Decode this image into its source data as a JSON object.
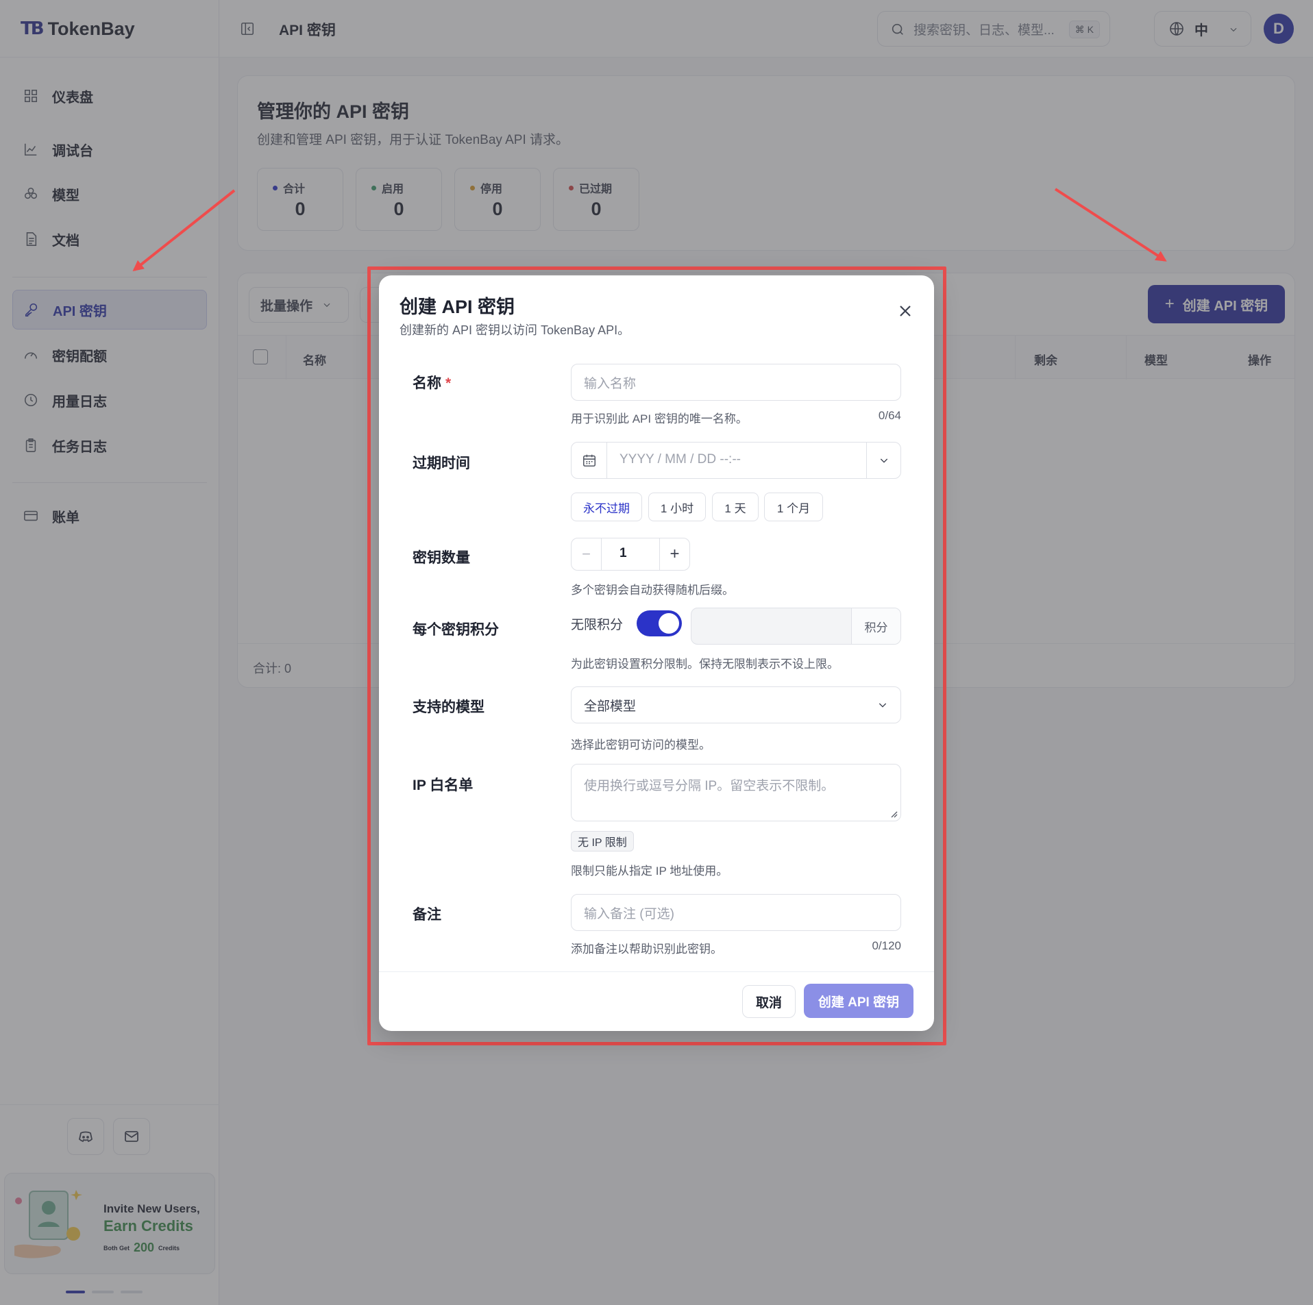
{
  "app": {
    "logo_mark": "TB",
    "name": "TokenBay"
  },
  "sidebar": {
    "items": [
      {
        "label": "仪表盘",
        "icon": "dashboard-icon"
      },
      {
        "label": "调试台",
        "icon": "chart-line-icon"
      },
      {
        "label": "模型",
        "icon": "cubes-icon"
      },
      {
        "label": "文档",
        "icon": "document-icon"
      },
      {
        "label": "API 密钥",
        "icon": "key-icon",
        "active": true
      },
      {
        "label": "密钥配额",
        "icon": "gauge-icon"
      },
      {
        "label": "用量日志",
        "icon": "clock-log-icon"
      },
      {
        "label": "任务日志",
        "icon": "clipboard-icon"
      },
      {
        "label": "账单",
        "icon": "credit-card-icon"
      }
    ],
    "social": [
      "discord-icon",
      "mail-icon"
    ],
    "promo": {
      "line1": "Invite New Users,",
      "line2": "Earn Credits",
      "line3_prefix": "Both Get",
      "line3_amount": "200",
      "line3_suffix": "Credits"
    }
  },
  "header": {
    "title": "API 密钥",
    "search_placeholder": "搜索密钥、日志、模型...",
    "shortcut": "⌘ K",
    "language": "中",
    "avatar_initial": "D"
  },
  "overview": {
    "title": "管理你的 API 密钥",
    "subtitle": "创建和管理 API 密钥，用于认证 TokenBay API 请求。",
    "stats": [
      {
        "label": "合计",
        "value": "0",
        "color": "#2b33c8"
      },
      {
        "label": "启用",
        "value": "0",
        "color": "#3a9a6a"
      },
      {
        "label": "停用",
        "value": "0",
        "color": "#d99a2b"
      },
      {
        "label": "已过期",
        "value": "0",
        "color": "#d04848"
      }
    ]
  },
  "table": {
    "bulk_label": "批量操作",
    "create_label": "创建 API 密钥",
    "columns": {
      "name": "名称",
      "remaining": "剩余",
      "model": "模型",
      "actions": "操作"
    },
    "footer_total": "合计:  0"
  },
  "modal": {
    "title": "创建 API 密钥",
    "subtitle": "创建新的 API 密钥以访问 TokenBay API。",
    "name": {
      "label": "名称",
      "required": "*",
      "placeholder": "输入名称",
      "help": "用于识别此 API 密钥的唯一名称。",
      "counter": "0/64"
    },
    "expiry": {
      "label": "过期时间",
      "placeholder": "YYYY / MM / DD --:--",
      "chips": [
        "永不过期",
        "1 小时",
        "1 天",
        "1 个月"
      ],
      "selected": "永不过期"
    },
    "count": {
      "label": "密钥数量",
      "value": "1",
      "help": "多个密钥会自动获得随机后缀。"
    },
    "credits": {
      "label": "每个密钥积分",
      "unlimited_label": "无限积分",
      "unlimited_on": true,
      "suffix": "积分",
      "help": "为此密钥设置积分限制。保持无限制表示不设上限。"
    },
    "models": {
      "label": "支持的模型",
      "value": "全部模型",
      "help": "选择此密钥可访问的模型。"
    },
    "ip": {
      "label": "IP 白名单",
      "placeholder": "使用换行或逗号分隔 IP。留空表示不限制。",
      "tag": "无 IP 限制",
      "help": "限制只能从指定 IP 地址使用。"
    },
    "note": {
      "label": "备注",
      "placeholder": "输入备注 (可选)",
      "help": "添加备注以帮助识别此密钥。",
      "counter": "0/120"
    },
    "cancel_label": "取消",
    "submit_label": "创建 API 密钥"
  },
  "annotation": {
    "highlight_color": "#e84e4e",
    "arrow_color": "#ef4c4c"
  }
}
